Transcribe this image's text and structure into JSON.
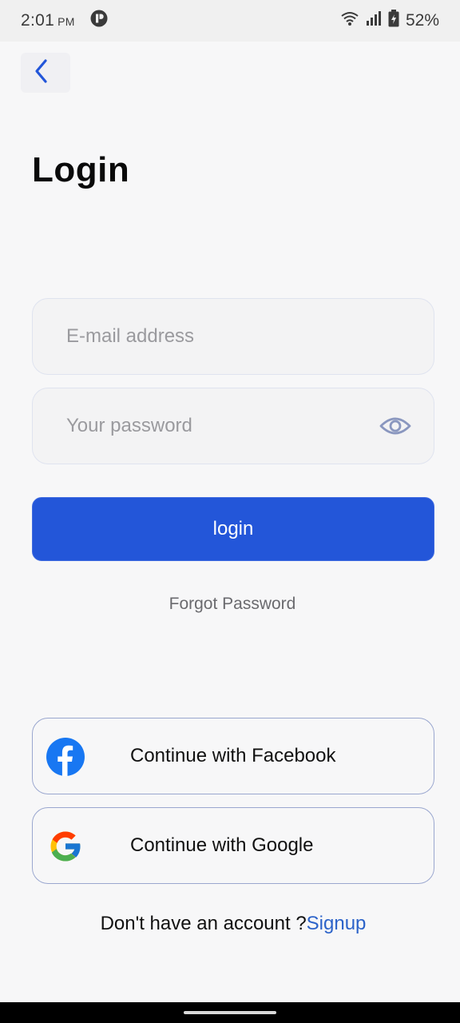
{
  "status_bar": {
    "time": "2:01",
    "ampm": "PM",
    "battery": "52%"
  },
  "header": {
    "title": "Login"
  },
  "form": {
    "email_placeholder": "E-mail address",
    "email_value": "",
    "password_placeholder": "Your password",
    "password_value": "",
    "login_label": "login",
    "forgot_label": "Forgot Password"
  },
  "social": {
    "facebook_label": "Continue with Facebook",
    "google_label": "Continue with Google"
  },
  "footer": {
    "prompt": "Don't have an account ?",
    "signup_label": "Signup"
  },
  "colors": {
    "accent": "#2356d9",
    "link": "#2c63c9",
    "facebook": "#1877f2"
  },
  "icons": [
    "back-arrow-icon",
    "eye-icon",
    "facebook-icon",
    "google-icon",
    "wifi-icon",
    "signal-icon",
    "battery-icon",
    "app-notification-icon"
  ]
}
